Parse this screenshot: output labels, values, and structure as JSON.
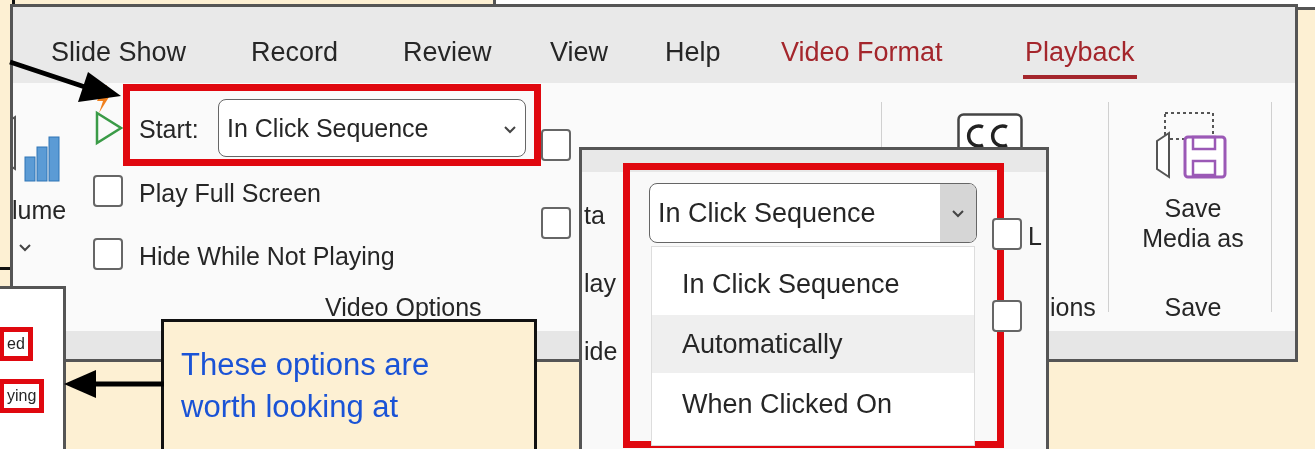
{
  "main_window": {
    "tabs": [
      {
        "label": "Slide Show",
        "selected": false,
        "contextual": false
      },
      {
        "label": "Record",
        "selected": false,
        "contextual": false
      },
      {
        "label": "Review",
        "selected": false,
        "contextual": false
      },
      {
        "label": "View",
        "selected": false,
        "contextual": false
      },
      {
        "label": "Help",
        "selected": false,
        "contextual": false
      },
      {
        "label": "Video Format",
        "selected": false,
        "contextual": true
      },
      {
        "label": "Playback",
        "selected": true,
        "contextual": true
      }
    ],
    "volume_label": "lume",
    "start": {
      "label": "Start:",
      "value": "In Click Sequence"
    },
    "checkboxes": [
      {
        "label": "Play Full Screen",
        "checked": false
      },
      {
        "label": "Hide While Not Playing",
        "checked": false
      }
    ],
    "group_label": "Video Options",
    "unlabeled_checkboxes": [
      {
        "checked": false
      },
      {
        "checked": false
      }
    ],
    "save_button": [
      "Save",
      "Media as"
    ],
    "save_group_label": "Save",
    "cut_text": "ions"
  },
  "popup": {
    "left_fragments": [
      "ta",
      "lay",
      "ide"
    ],
    "dropdown_value": "In Click Sequence",
    "options": [
      {
        "label": "In Click Sequence",
        "highlighted": false
      },
      {
        "label": "Automatically",
        "highlighted": true
      },
      {
        "label": "When Clicked On",
        "highlighted": false
      }
    ],
    "right_checkboxes": [
      {
        "label": "L",
        "checked": false
      },
      {
        "checked": false
      }
    ]
  },
  "side_window": {
    "fragments": [
      "ed",
      "ying"
    ]
  },
  "callout": {
    "text": "These options are worth looking at"
  }
}
